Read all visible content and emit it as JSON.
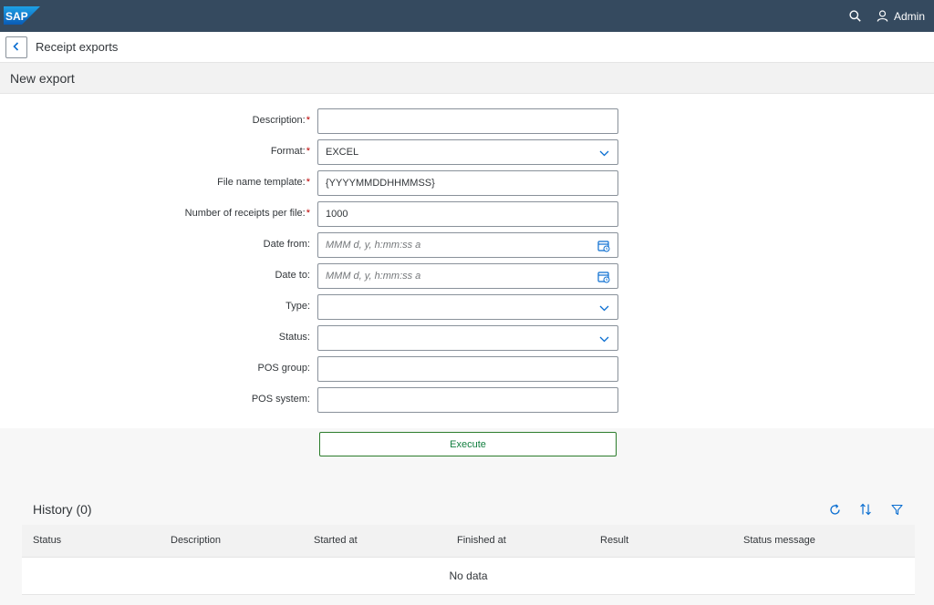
{
  "shell": {
    "logo_text": "SAP",
    "user_name": "Admin",
    "brand_color": "#354a5f",
    "logo_color": "#0a6ed1"
  },
  "page": {
    "title": "Receipt exports",
    "section_title": "New export"
  },
  "form": {
    "fields": [
      {
        "label": "Description:",
        "required": true,
        "value": "",
        "placeholder": "",
        "icon": ""
      },
      {
        "label": "Format:",
        "required": true,
        "value": "EXCEL",
        "placeholder": "",
        "icon": "chevron-down-icon"
      },
      {
        "label": "File name template:",
        "required": true,
        "value": "{YYYYMMDDHHMMSS}",
        "placeholder": "",
        "icon": ""
      },
      {
        "label": "Number of receipts per file:",
        "required": true,
        "value": "1000",
        "placeholder": "",
        "icon": ""
      },
      {
        "label": "Date from:",
        "required": false,
        "value": "",
        "placeholder": "MMM d, y, h:mm:ss a",
        "icon": "calendar-icon"
      },
      {
        "label": "Date to:",
        "required": false,
        "value": "",
        "placeholder": "MMM d, y, h:mm:ss a",
        "icon": "calendar-icon"
      },
      {
        "label": "Type:",
        "required": false,
        "value": "",
        "placeholder": "",
        "icon": "chevron-down-icon"
      },
      {
        "label": "Status:",
        "required": false,
        "value": "",
        "placeholder": "",
        "icon": "chevron-down-icon"
      },
      {
        "label": "POS group:",
        "required": false,
        "value": "",
        "placeholder": "",
        "icon": ""
      },
      {
        "label": "POS system:",
        "required": false,
        "value": "",
        "placeholder": "",
        "icon": ""
      }
    ],
    "required_mark": "*",
    "execute_label": "Execute",
    "execute_color": "#107e3e"
  },
  "history": {
    "title": "History (0)",
    "columns": [
      "Status",
      "Description",
      "Started at",
      "Finished at",
      "Result",
      "Status message"
    ],
    "empty_text": "No data",
    "tools": [
      "refresh-icon",
      "sort-icon",
      "filter-icon"
    ]
  }
}
